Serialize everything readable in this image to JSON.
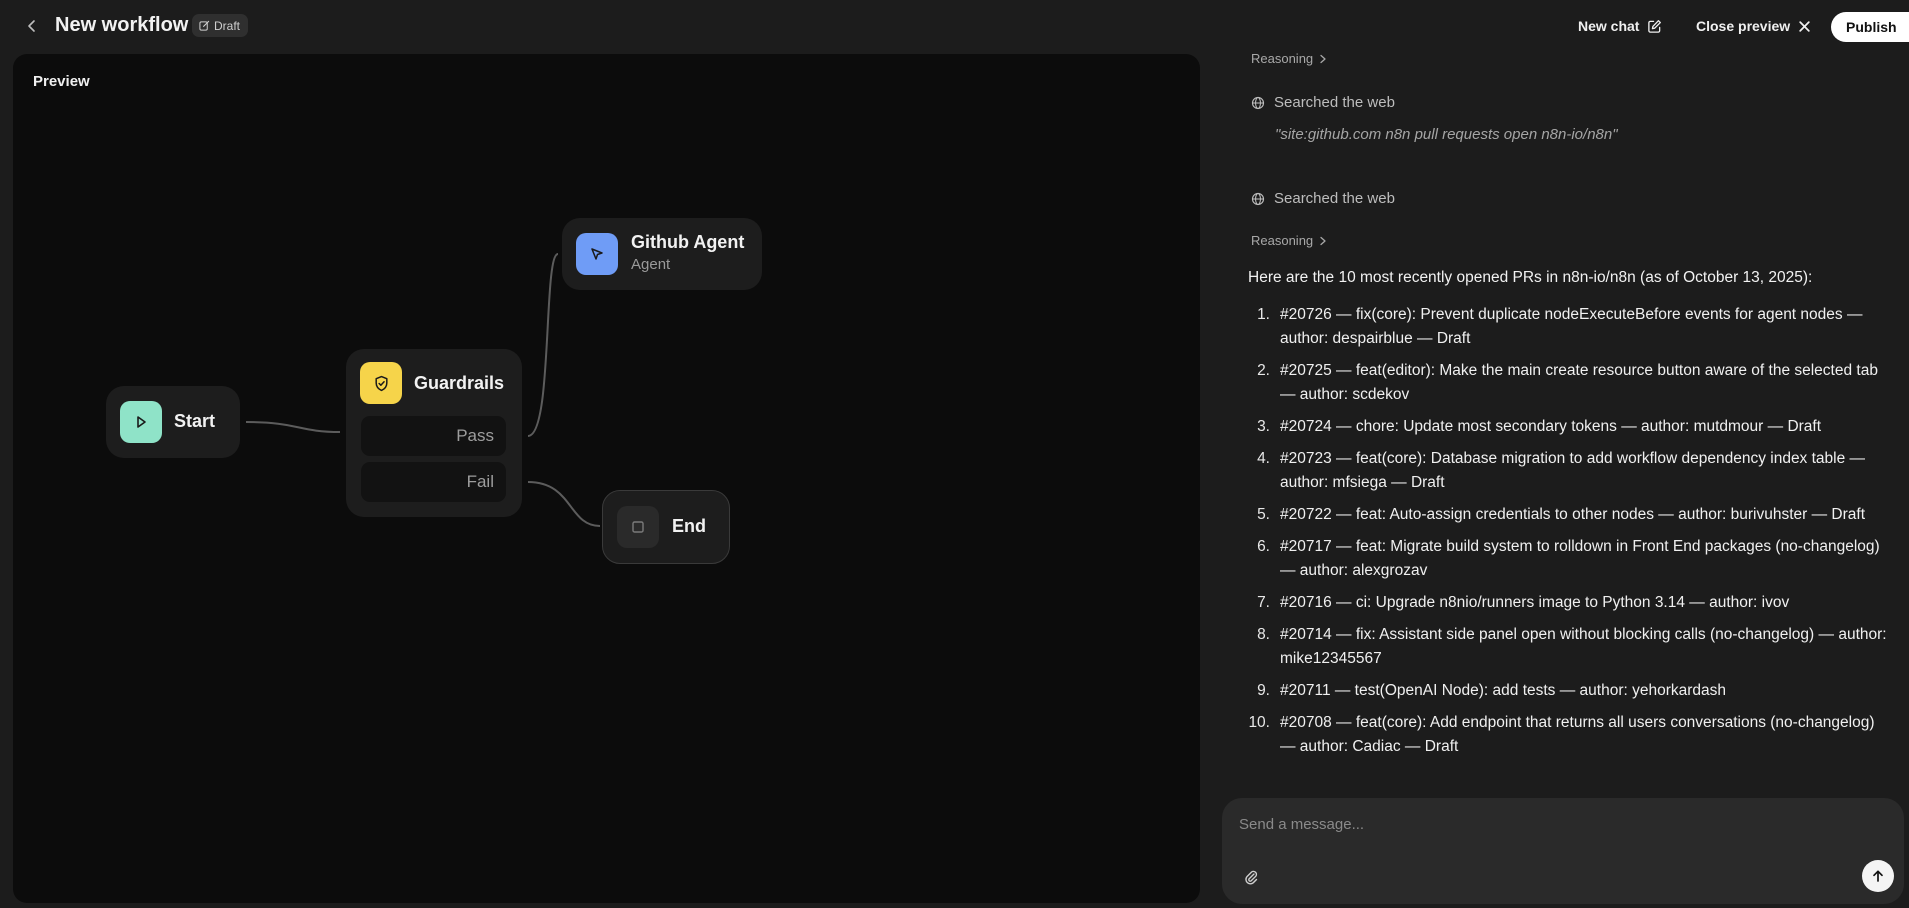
{
  "header": {
    "title": "New workflow",
    "badge": "Draft",
    "new_chat": "New chat",
    "close_preview": "Close preview",
    "publish": "Publish"
  },
  "preview": {
    "label": "Preview",
    "nodes": {
      "start": {
        "title": "Start",
        "color": "#8fe3c8"
      },
      "guardrails": {
        "title": "Guardrails",
        "pass": "Pass",
        "fail": "Fail",
        "color": "#f6d44a"
      },
      "github_agent": {
        "title": "Github Agent",
        "subtitle": "Agent",
        "color": "#6f9cf6"
      },
      "end": {
        "title": "End"
      }
    }
  },
  "chat": {
    "reasoning_label": "Reasoning",
    "searched_label": "Searched the web",
    "search_query": "\"site:github.com n8n pull requests open n8n-io/n8n\"",
    "intro": "Here are the 10 most recently opened PRs in n8n-io/n8n (as of October 13, 2025):",
    "prs": [
      {
        "num": "1.",
        "text": "#20726 — fix(core): Prevent duplicate nodeExecuteBefore events for agent nodes — author: despairblue — Draft"
      },
      {
        "num": "2.",
        "text": "#20725 — feat(editor): Make the main create resource button aware of the selected tab — author: scdekov"
      },
      {
        "num": "3.",
        "text": "#20724 — chore: Update most secondary tokens — author: mutdmour — Draft"
      },
      {
        "num": "4.",
        "text": "#20723 — feat(core): Database migration to add workflow dependency index table — author: mfsiega — Draft"
      },
      {
        "num": "5.",
        "text": "#20722 — feat: Auto-assign credentials to other nodes — author: burivuhster — Draft"
      },
      {
        "num": "6.",
        "text": "#20717 — feat: Migrate build system to rolldown in Front End packages (no-changelog) — author: alexgrozav"
      },
      {
        "num": "7.",
        "text": "#20716 — ci: Upgrade n8nio/runners image to Python 3.14 — author: ivov"
      },
      {
        "num": "8.",
        "text": "#20714 — fix: Assistant side panel open without blocking calls (no-changelog) — author: mike12345567"
      },
      {
        "num": "9.",
        "text": "#20711 — test(OpenAI Node): add tests — author: yehorkardash"
      },
      {
        "num": "10.",
        "text": "#20708 — feat(core): Add endpoint that returns all users conversations (no-changelog) — author: Cadiac — Draft"
      }
    ],
    "composer": {
      "placeholder": "Send a message..."
    }
  }
}
